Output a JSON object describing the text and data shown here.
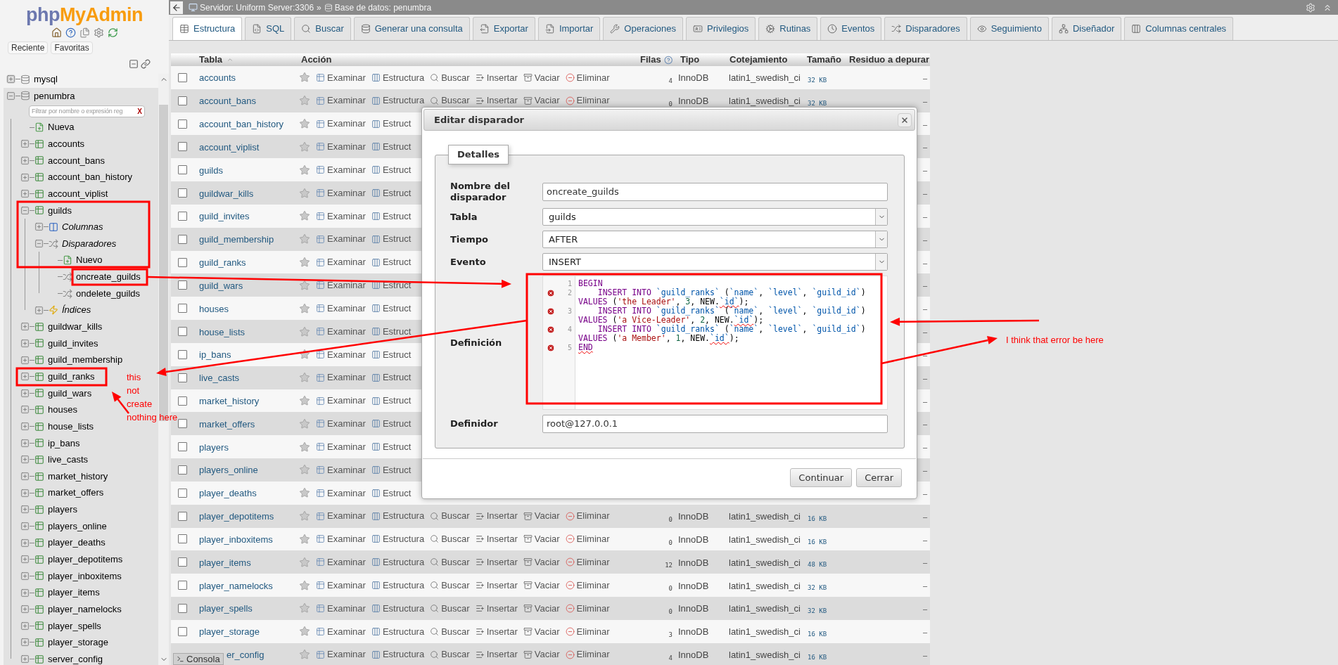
{
  "navigation": {
    "logo": {
      "part_1": "php",
      "part_2": "MyAdmin"
    },
    "tabs": [
      {
        "label": "Reciente"
      },
      {
        "label": "Favoritas"
      }
    ],
    "tree": [
      {
        "label": "mysql",
        "kind": "database",
        "expanded": false
      },
      {
        "label": "penumbra",
        "kind": "database",
        "expanded": true,
        "filter": {
          "placeholder": "Filtrar por nombre o expresión reg",
          "clear": "X"
        },
        "children": [
          {
            "label": "Nueva",
            "kind": "new"
          },
          {
            "label": "accounts",
            "kind": "table",
            "expanded": false
          },
          {
            "label": "account_bans",
            "kind": "table",
            "expanded": false
          },
          {
            "label": "account_ban_history",
            "kind": "table",
            "expanded": false
          },
          {
            "label": "account_viplist",
            "kind": "table",
            "expanded": false
          },
          {
            "label": "guilds",
            "kind": "table",
            "expanded": true,
            "children": [
              {
                "label": "Columnas",
                "kind": "columns",
                "expanded": false
              },
              {
                "label": "Disparadores",
                "kind": "triggers",
                "expanded": true,
                "children": [
                  {
                    "label": "Nuevo",
                    "kind": "new"
                  },
                  {
                    "label": "oncreate_guilds",
                    "kind": "trigger"
                  },
                  {
                    "label": "ondelete_guilds",
                    "kind": "trigger"
                  }
                ]
              },
              {
                "label": "Índices",
                "kind": "indexes",
                "expanded": false
              }
            ]
          },
          {
            "label": "guildwar_kills",
            "kind": "table",
            "expanded": false
          },
          {
            "label": "guild_invites",
            "kind": "table",
            "expanded": false
          },
          {
            "label": "guild_membership",
            "kind": "table",
            "expanded": false
          },
          {
            "label": "guild_ranks",
            "kind": "table",
            "expanded": false
          },
          {
            "label": "guild_wars",
            "kind": "table",
            "expanded": false
          },
          {
            "label": "houses",
            "kind": "table",
            "expanded": false
          },
          {
            "label": "house_lists",
            "kind": "table",
            "expanded": false
          },
          {
            "label": "ip_bans",
            "kind": "table",
            "expanded": false
          },
          {
            "label": "live_casts",
            "kind": "table",
            "expanded": false
          },
          {
            "label": "market_history",
            "kind": "table",
            "expanded": false
          },
          {
            "label": "market_offers",
            "kind": "table",
            "expanded": false
          },
          {
            "label": "players",
            "kind": "table",
            "expanded": false
          },
          {
            "label": "players_online",
            "kind": "table",
            "expanded": false
          },
          {
            "label": "player_deaths",
            "kind": "table",
            "expanded": false
          },
          {
            "label": "player_depotitems",
            "kind": "table",
            "expanded": false
          },
          {
            "label": "player_inboxitems",
            "kind": "table",
            "expanded": false
          },
          {
            "label": "player_items",
            "kind": "table",
            "expanded": false
          },
          {
            "label": "player_namelocks",
            "kind": "table",
            "expanded": false
          },
          {
            "label": "player_spells",
            "kind": "table",
            "expanded": false
          },
          {
            "label": "player_storage",
            "kind": "table",
            "expanded": false
          },
          {
            "label": "server_config",
            "kind": "table",
            "expanded": false
          }
        ]
      }
    ]
  },
  "breadcrumb": {
    "server": "Servidor: Uniform Server:3306",
    "separator": "»",
    "database": "Base de datos: penumbra"
  },
  "tabs": [
    {
      "label": "Estructura",
      "selected": true
    },
    {
      "label": "SQL",
      "selected": false
    },
    {
      "label": "Buscar",
      "selected": false
    },
    {
      "label": "Generar una consulta",
      "selected": false
    },
    {
      "label": "Exportar",
      "selected": false
    },
    {
      "label": "Importar",
      "selected": false
    },
    {
      "label": "Operaciones",
      "selected": false
    },
    {
      "label": "Privilegios",
      "selected": false
    },
    {
      "label": "Rutinas",
      "selected": false
    },
    {
      "label": "Eventos",
      "selected": false
    },
    {
      "label": "Disparadores",
      "selected": false
    },
    {
      "label": "Seguimiento",
      "selected": false
    },
    {
      "label": "Diseñador",
      "selected": false
    },
    {
      "label": "Columnas centrales",
      "selected": false
    }
  ],
  "table": {
    "columns": [
      {
        "label": "Tabla",
        "kind": "sortable"
      },
      {
        "label": "Acción",
        "kind": "plain"
      },
      {
        "label": "Filas",
        "kind": "help"
      },
      {
        "label": "Tipo",
        "kind": "plain"
      },
      {
        "label": "Cotejamiento",
        "kind": "plain"
      },
      {
        "label": "Tamaño",
        "kind": "plain"
      },
      {
        "label": "Residuo a depurar",
        "kind": "plain"
      }
    ],
    "rows": [
      {
        "kind": "table",
        "checked": false,
        "name": "accounts",
        "favorite": false,
        "actions": [
          "Examinar",
          "Estructura",
          "Buscar",
          "Insertar",
          "Vaciar",
          "Eliminar"
        ],
        "row_count": "4",
        "engine": "InnoDB",
        "collation": "latin1_swedish_ci",
        "size": "32 KB",
        "overhead": "–"
      },
      {
        "kind": "table",
        "checked": false,
        "name": "account_bans",
        "favorite": false,
        "actions": [
          "Examinar",
          "Estructura",
          "Buscar",
          "Insertar",
          "Vaciar",
          "Eliminar"
        ],
        "row_count": "0",
        "engine": "InnoDB",
        "collation": "latin1_swedish_ci",
        "size": "32 KB",
        "overhead": "–"
      },
      {
        "kind": "table",
        "checked": false,
        "name": "account_ban_history",
        "favorite": false,
        "actions": [
          "Examinar",
          "Estruct"
        ],
        "overhead": "–"
      },
      {
        "kind": "table",
        "checked": false,
        "name": "account_viplist",
        "favorite": false,
        "actions": [
          "Examinar",
          "Estruct"
        ],
        "overhead": "–"
      },
      {
        "kind": "table",
        "checked": false,
        "name": "guilds",
        "favorite": false,
        "actions": [
          "Examinar",
          "Estruct"
        ],
        "overhead": "–"
      },
      {
        "kind": "table",
        "checked": false,
        "name": "guildwar_kills",
        "favorite": false,
        "actions": [
          "Examinar",
          "Estruct"
        ],
        "overhead": "–"
      },
      {
        "kind": "table",
        "checked": false,
        "name": "guild_invites",
        "favorite": false,
        "actions": [
          "Examinar",
          "Estruct"
        ],
        "overhead": "–"
      },
      {
        "kind": "table",
        "checked": false,
        "name": "guild_membership",
        "favorite": false,
        "actions": [
          "Examinar",
          "Estruct"
        ],
        "overhead": "–"
      },
      {
        "kind": "table",
        "checked": false,
        "name": "guild_ranks",
        "favorite": false,
        "actions": [
          "Examinar",
          "Estruct"
        ],
        "overhead": "–"
      },
      {
        "kind": "table",
        "checked": false,
        "name": "guild_wars",
        "favorite": false,
        "actions": [
          "Examinar",
          "Estruct"
        ],
        "overhead": "–"
      },
      {
        "kind": "table",
        "checked": false,
        "name": "houses",
        "favorite": false,
        "actions": [
          "Examinar",
          "Estruct"
        ],
        "overhead": "–"
      },
      {
        "kind": "table",
        "checked": false,
        "name": "house_lists",
        "favorite": false,
        "actions": [
          "Examinar",
          "Estruct"
        ],
        "overhead": "–"
      },
      {
        "kind": "table",
        "checked": false,
        "name": "ip_bans",
        "favorite": false,
        "actions": [
          "Examinar",
          "Estruct"
        ],
        "overhead": "–"
      },
      {
        "kind": "table",
        "checked": false,
        "name": "live_casts",
        "favorite": false,
        "actions": [
          "Examinar",
          "Estruct"
        ],
        "overhead": "–"
      },
      {
        "kind": "table",
        "checked": false,
        "name": "market_history",
        "favorite": false,
        "actions": [
          "Examinar",
          "Estruct"
        ],
        "overhead": "–"
      },
      {
        "kind": "table",
        "checked": false,
        "name": "market_offers",
        "favorite": false,
        "actions": [
          "Examinar",
          "Estruct"
        ],
        "overhead": "–"
      },
      {
        "kind": "table",
        "checked": false,
        "name": "players",
        "favorite": false,
        "actions": [
          "Examinar",
          "Estruct"
        ],
        "overhead": "–"
      },
      {
        "kind": "table",
        "checked": false,
        "name": "players_online",
        "favorite": false,
        "actions": [
          "Examinar",
          "Estruct"
        ],
        "overhead": "–"
      },
      {
        "kind": "table",
        "checked": false,
        "name": "player_deaths",
        "favorite": false,
        "actions": [
          "Examinar",
          "Estruct"
        ],
        "overhead": "–"
      },
      {
        "kind": "table",
        "checked": false,
        "name": "player_depotitems",
        "favorite": false,
        "actions": [
          "Examinar",
          "Estructura",
          "Buscar",
          "Insertar",
          "Vaciar",
          "Eliminar"
        ],
        "row_count": "0",
        "engine": "InnoDB",
        "collation": "latin1_swedish_ci",
        "size": "16 KB",
        "overhead": "–"
      },
      {
        "kind": "table",
        "checked": false,
        "name": "player_inboxitems",
        "favorite": false,
        "actions": [
          "Examinar",
          "Estructura",
          "Buscar",
          "Insertar",
          "Vaciar",
          "Eliminar"
        ],
        "row_count": "0",
        "engine": "InnoDB",
        "collation": "latin1_swedish_ci",
        "size": "16 KB",
        "overhead": "–"
      },
      {
        "kind": "table",
        "checked": false,
        "name": "player_items",
        "favorite": false,
        "actions": [
          "Examinar",
          "Estructura",
          "Buscar",
          "Insertar",
          "Vaciar",
          "Eliminar"
        ],
        "row_count": "12",
        "engine": "InnoDB",
        "collation": "latin1_swedish_ci",
        "size": "48 KB",
        "overhead": "–"
      },
      {
        "kind": "table",
        "checked": false,
        "name": "player_namelocks",
        "favorite": false,
        "actions": [
          "Examinar",
          "Estructura",
          "Buscar",
          "Insertar",
          "Vaciar",
          "Eliminar"
        ],
        "row_count": "0",
        "engine": "InnoDB",
        "collation": "latin1_swedish_ci",
        "size": "32 KB",
        "overhead": "–"
      },
      {
        "kind": "table",
        "checked": false,
        "name": "player_spells",
        "favorite": false,
        "actions": [
          "Examinar",
          "Estructura",
          "Buscar",
          "Insertar",
          "Vaciar",
          "Eliminar"
        ],
        "row_count": "0",
        "engine": "InnoDB",
        "collation": "latin1_swedish_ci",
        "size": "32 KB",
        "overhead": "–"
      },
      {
        "kind": "table",
        "checked": false,
        "name": "player_storage",
        "favorite": false,
        "actions": [
          "Examinar",
          "Estructura",
          "Buscar",
          "Insertar",
          "Vaciar",
          "Eliminar"
        ],
        "row_count": "3",
        "engine": "InnoDB",
        "collation": "latin1_swedish_ci",
        "size": "16 KB",
        "overhead": "–"
      },
      {
        "kind": "clipped",
        "name": "er_config",
        "favorite": false,
        "actions": [
          "Examinar",
          "Estructura",
          "Buscar",
          "Insertar",
          "Vaciar",
          "Eliminar"
        ],
        "row_count": "4",
        "engine": "InnoDB",
        "collation": "latin1_swedish_ci",
        "size": "16 KB",
        "overhead": "–"
      }
    ]
  },
  "console": {
    "label": "Consola"
  },
  "dialog": {
    "title": "Editar disparador",
    "legend": "Detalles",
    "fields": [
      {
        "label": "Nombre del disparador",
        "kind": "text",
        "value": "oncreate_guilds"
      },
      {
        "label": "Tabla",
        "kind": "select",
        "value": "guilds"
      },
      {
        "label": "Tiempo",
        "kind": "select",
        "value": "AFTER"
      },
      {
        "label": "Evento",
        "kind": "select",
        "value": "INSERT"
      },
      {
        "label": "Definición",
        "kind": "code",
        "lines": [
          {
            "number": "1",
            "error": false,
            "tokens": [
              {
                "kind": "keyword",
                "text": "BEGIN"
              }
            ]
          },
          {
            "number": "2",
            "error": true,
            "tokens": [
              {
                "kind": "keyword",
                "text": "    INSERT INTO "
              },
              {
                "kind": "identifier",
                "text": "`guild_ranks`"
              },
              {
                "kind": "plain",
                "text": " ("
              },
              {
                "kind": "identifier",
                "text": "`name`"
              },
              {
                "kind": "plain",
                "text": ", "
              },
              {
                "kind": "identifier",
                "text": "`level`"
              },
              {
                "kind": "plain",
                "text": ", "
              },
              {
                "kind": "identifier",
                "text": "`guild_id`"
              },
              {
                "kind": "plain",
                "text": ") "
              },
              {
                "kind": "keyword",
                "text": "VALUES"
              },
              {
                "kind": "plain",
                "text": " ("
              },
              {
                "kind": "string",
                "text": "'the Leader'"
              },
              {
                "kind": "plain",
                "text": ", "
              },
              {
                "kind": "number",
                "text": "3"
              },
              {
                "kind": "plain",
                "text": ", NEW."
              },
              {
                "kind": "identifier",
                "text": "`id`",
                "squiggle": true
              },
              {
                "kind": "plain",
                "text": ");"
              }
            ]
          },
          {
            "number": "3",
            "error": true,
            "tokens": [
              {
                "kind": "keyword",
                "text": "    INSERT INTO "
              },
              {
                "kind": "identifier",
                "text": "`guild_ranks`"
              },
              {
                "kind": "plain",
                "text": " ("
              },
              {
                "kind": "identifier",
                "text": "`name`"
              },
              {
                "kind": "plain",
                "text": ", "
              },
              {
                "kind": "identifier",
                "text": "`level`"
              },
              {
                "kind": "plain",
                "text": ", "
              },
              {
                "kind": "identifier",
                "text": "`guild_id`"
              },
              {
                "kind": "plain",
                "text": ") "
              },
              {
                "kind": "keyword",
                "text": "VALUES"
              },
              {
                "kind": "plain",
                "text": " ("
              },
              {
                "kind": "string",
                "text": "'a Vice-Leader'"
              },
              {
                "kind": "plain",
                "text": ", "
              },
              {
                "kind": "number",
                "text": "2"
              },
              {
                "kind": "plain",
                "text": ", NEW."
              },
              {
                "kind": "identifier",
                "text": "`id`",
                "squiggle": true
              },
              {
                "kind": "plain",
                "text": ");"
              }
            ]
          },
          {
            "number": "4",
            "error": true,
            "tokens": [
              {
                "kind": "keyword",
                "text": "    INSERT INTO "
              },
              {
                "kind": "identifier",
                "text": "`guild_ranks`"
              },
              {
                "kind": "plain",
                "text": " ("
              },
              {
                "kind": "identifier",
                "text": "`name`"
              },
              {
                "kind": "plain",
                "text": ", "
              },
              {
                "kind": "identifier",
                "text": "`level`"
              },
              {
                "kind": "plain",
                "text": ", "
              },
              {
                "kind": "identifier",
                "text": "`guild_id`"
              },
              {
                "kind": "plain",
                "text": ") "
              },
              {
                "kind": "keyword",
                "text": "VALUES"
              },
              {
                "kind": "plain",
                "text": " ("
              },
              {
                "kind": "string",
                "text": "'a Member'"
              },
              {
                "kind": "plain",
                "text": ", "
              },
              {
                "kind": "number",
                "text": "1"
              },
              {
                "kind": "plain",
                "text": ", NEW."
              },
              {
                "kind": "identifier",
                "text": "`id`",
                "squiggle": true
              },
              {
                "kind": "plain",
                "text": ");"
              }
            ]
          },
          {
            "number": "5",
            "error": true,
            "tokens": [
              {
                "kind": "keyword",
                "text": "END",
                "squiggle": true
              }
            ]
          }
        ]
      },
      {
        "label": "Definidor",
        "kind": "text",
        "value": "root@127.0.0.1"
      }
    ],
    "buttons": [
      "Continuar",
      "Cerrar"
    ]
  },
  "annotations": [
    {
      "text": "this\nnot\ncreate\nnothing here"
    },
    {
      "text": "I think that error be here"
    }
  ]
}
